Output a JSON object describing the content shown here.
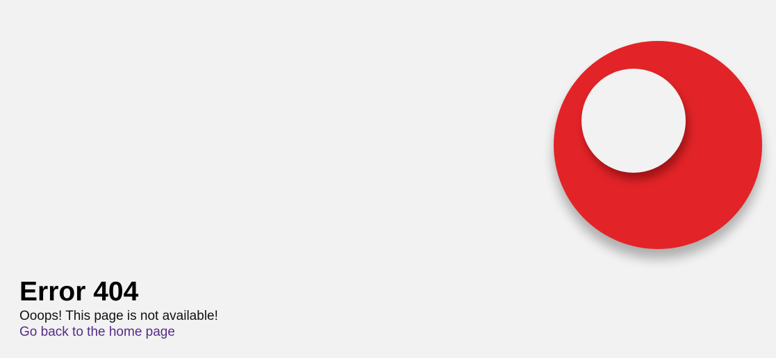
{
  "error": {
    "title": "Error 404",
    "message": "Ooops! This page is not available!",
    "home_link": "Go back to the home page"
  },
  "colors": {
    "background": "#f2f2f2",
    "ball": "#e22428",
    "link": "#552c86"
  }
}
